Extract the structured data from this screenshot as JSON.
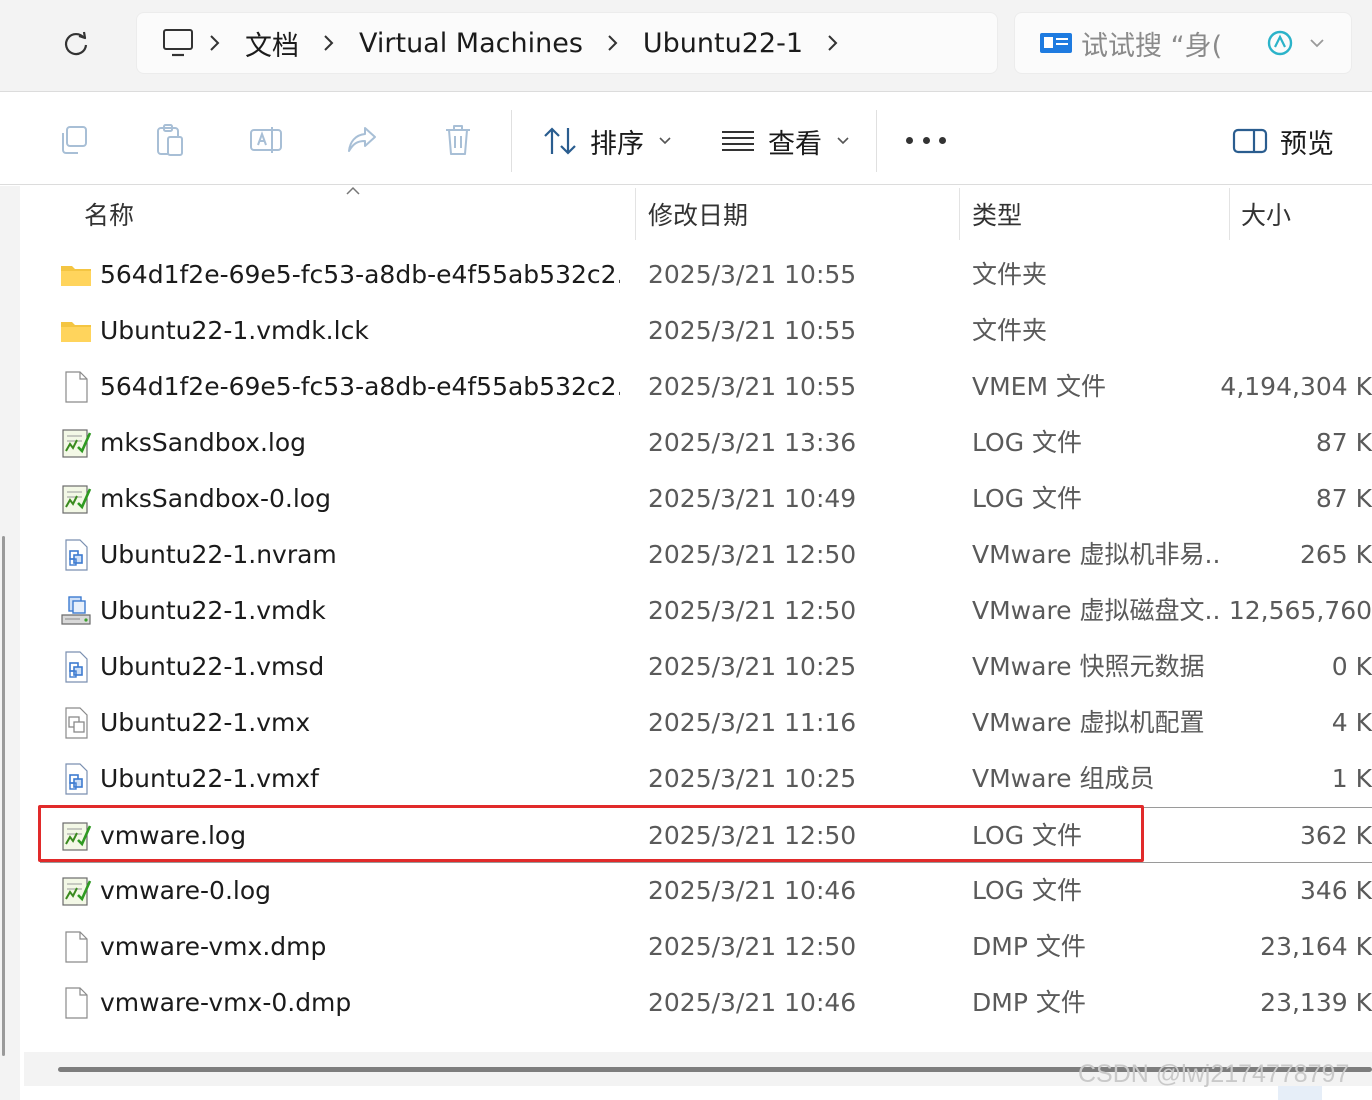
{
  "address_bar": {
    "crumbs": [
      "文档",
      "Virtual Machines",
      "Ubuntu22-1"
    ],
    "search_placeholder": "试试搜 “身("
  },
  "toolbar": {
    "sort_label": "排序",
    "view_label": "查看",
    "preview_label": "预览"
  },
  "columns": {
    "name": "名称",
    "modified": "修改日期",
    "type": "类型",
    "size": "大小"
  },
  "files": [
    {
      "icon": "folder-icon",
      "name": "564d1f2e-69e5-fc53-a8db-e4f55ab532c2.v...",
      "date": "2025/3/21 10:55",
      "type": "文件夹",
      "size": ""
    },
    {
      "icon": "folder-icon",
      "name": "Ubuntu22-1.vmdk.lck",
      "date": "2025/3/21 10:55",
      "type": "文件夹",
      "size": ""
    },
    {
      "icon": "blank-file-icon",
      "name": "564d1f2e-69e5-fc53-a8db-e4f55ab532c2.v...",
      "date": "2025/3/21 10:55",
      "type": "VMEM 文件",
      "size": "4,194,304 K"
    },
    {
      "icon": "log-file-icon",
      "name": "mksSandbox.log",
      "date": "2025/3/21 13:36",
      "type": "LOG 文件",
      "size": "87 K"
    },
    {
      "icon": "log-file-icon",
      "name": "mksSandbox-0.log",
      "date": "2025/3/21 10:49",
      "type": "LOG 文件",
      "size": "87 K"
    },
    {
      "icon": "vmware-file-icon",
      "name": "Ubuntu22-1.nvram",
      "date": "2025/3/21 12:50",
      "type": "VMware 虚拟机非易...",
      "size": "265 K"
    },
    {
      "icon": "vmware-disk-icon",
      "name": "Ubuntu22-1.vmdk",
      "date": "2025/3/21 12:50",
      "type": "VMware 虚拟磁盘文...",
      "size": "12,565,760"
    },
    {
      "icon": "vmware-file-icon",
      "name": "Ubuntu22-1.vmsd",
      "date": "2025/3/21 10:25",
      "type": "VMware 快照元数据",
      "size": "0 K"
    },
    {
      "icon": "vmx-file-icon",
      "name": "Ubuntu22-1.vmx",
      "date": "2025/3/21 11:16",
      "type": "VMware 虚拟机配置",
      "size": "4 K"
    },
    {
      "icon": "vmware-file-icon",
      "name": "Ubuntu22-1.vmxf",
      "date": "2025/3/21 10:25",
      "type": "VMware 组成员",
      "size": "1 K"
    },
    {
      "icon": "log-file-icon",
      "name": "vmware.log",
      "date": "2025/3/21 12:50",
      "type": "LOG 文件",
      "size": "362 K"
    },
    {
      "icon": "log-file-icon",
      "name": "vmware-0.log",
      "date": "2025/3/21 10:46",
      "type": "LOG 文件",
      "size": "346 K"
    },
    {
      "icon": "blank-file-icon",
      "name": "vmware-vmx.dmp",
      "date": "2025/3/21 12:50",
      "type": "DMP 文件",
      "size": "23,164 K"
    },
    {
      "icon": "blank-file-icon",
      "name": "vmware-vmx-0.dmp",
      "date": "2025/3/21 10:46",
      "type": "DMP 文件",
      "size": "23,139 K"
    }
  ],
  "selected_file": "vmware.log",
  "highlight_color": "#e12a2a",
  "watermark": "CSDN @lwj2174778797"
}
